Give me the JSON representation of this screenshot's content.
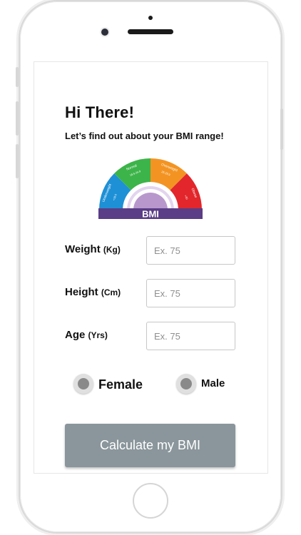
{
  "header": {
    "title": "Hi There!",
    "subtitle": "Let’s find out about your BMI range!"
  },
  "gauge": {
    "label": "BMI",
    "segments": [
      {
        "name": "Underweight",
        "range": "<18.5",
        "color": "#1e90d6"
      },
      {
        "name": "Normal",
        "range": "18.5-24.9",
        "color": "#3cb449"
      },
      {
        "name": "Overweight",
        "range": "25-29.9",
        "color": "#f39422"
      },
      {
        "name": "Obese",
        "range": ">30",
        "color": "#e2262b"
      }
    ],
    "inner_color": "#b898cc",
    "bar_color": "#5a3d86"
  },
  "form": {
    "weight": {
      "label": "Weight",
      "unit": "(Kg)",
      "placeholder": "Ex. 75"
    },
    "height": {
      "label": "Height",
      "unit": "(Cm)",
      "placeholder": "Ex. 75"
    },
    "age": {
      "label": "Age",
      "unit": "(Yrs)",
      "placeholder": "Ex. 75"
    },
    "gender": {
      "female_label": "Female",
      "male_label": "Male"
    }
  },
  "actions": {
    "calculate_label": "Calculate my BMI",
    "button_color": "#8a969b"
  }
}
